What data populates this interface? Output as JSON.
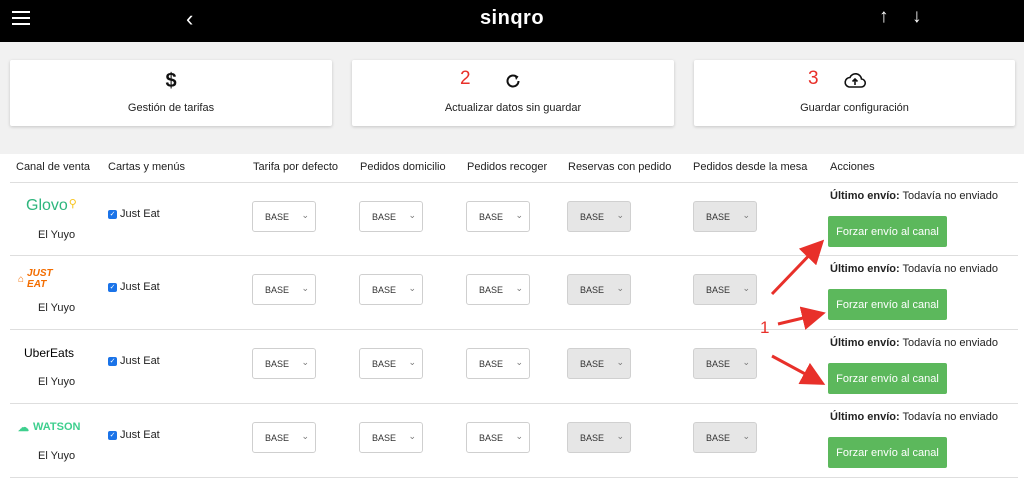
{
  "header": {
    "brand": "sinqro",
    "back_icon": "chevron-left-icon",
    "menu_icon": "hamburger-icon",
    "up_icon": "arrow-up-icon",
    "down_icon": "arrow-down-icon"
  },
  "actions": [
    {
      "label": "Gestión de tarifas",
      "icon": "dollar-icon",
      "marker": ""
    },
    {
      "label": "Actualizar datos sin guardar",
      "icon": "refresh-icon",
      "marker": "2"
    },
    {
      "label": "Guardar configuración",
      "icon": "cloud-upload-icon",
      "marker": "3"
    }
  ],
  "table": {
    "columns": [
      "Canal de venta",
      "Cartas y menús",
      "Tarifa por defecto",
      "Pedidos domicilio",
      "Pedidos recoger",
      "Reservas con pedido",
      "Pedidos desde la mesa",
      "Acciones"
    ],
    "rows": [
      {
        "channel": "Glovo",
        "store": "El Yuyo",
        "menu": "Just Eat",
        "tarifa": "BASE",
        "domicilio": "BASE",
        "recoger": "BASE",
        "reservas": "BASE",
        "mesa": "BASE",
        "last_label": "Último envío:",
        "last_value": " Todavía no enviado",
        "button": "Forzar envío al canal"
      },
      {
        "channel": "JUST EAT",
        "store": "El Yuyo",
        "menu": "Just Eat",
        "tarifa": "BASE",
        "domicilio": "BASE",
        "recoger": "BASE",
        "reservas": "BASE",
        "mesa": "BASE",
        "last_label": "Último envío:",
        "last_value": " Todavía no enviado",
        "button": "Forzar envío al canal"
      },
      {
        "channel": "UberEats",
        "store": "El Yuyo",
        "menu": "Just Eat",
        "tarifa": "BASE",
        "domicilio": "BASE",
        "recoger": "BASE",
        "reservas": "BASE",
        "mesa": "BASE",
        "last_label": "Último envío:",
        "last_value": " Todavía no enviado",
        "button": "Forzar envío al canal"
      },
      {
        "channel": "WATSON",
        "store": "El Yuyo",
        "menu": "Just Eat",
        "tarifa": "BASE",
        "domicilio": "BASE",
        "recoger": "BASE",
        "reservas": "BASE",
        "mesa": "BASE",
        "last_label": "Último envío:",
        "last_value": " Todavía no enviado",
        "button": "Forzar envío al canal"
      }
    ]
  },
  "annotations": {
    "marker_1": "1",
    "arrow_color": "#e8302a"
  },
  "colors": {
    "topbar": "#000000",
    "button_green": "#5cb85c",
    "glovo": "#2eb67d",
    "justeat": "#f36d00",
    "watson": "#3ecf8e"
  }
}
